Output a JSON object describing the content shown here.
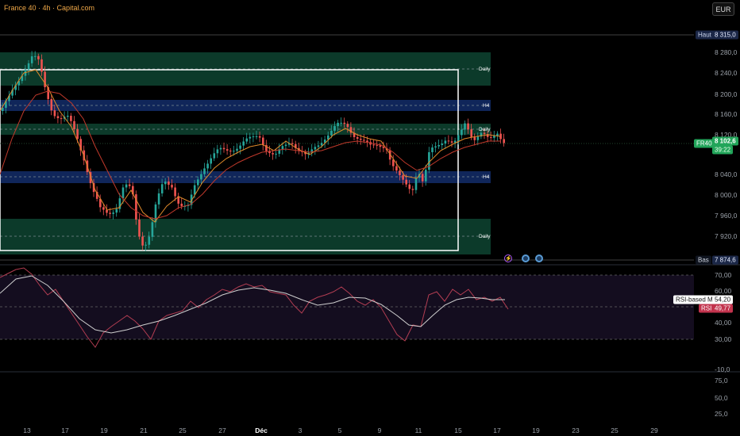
{
  "header": {
    "title": "France 40 · 4h · Capital.com"
  },
  "toolbar": {
    "currency": "EUR"
  },
  "price_axis": {
    "ticks": [
      "8 280,0",
      "8 240,0",
      "8 200,0",
      "8 160,0",
      "8 120,0",
      "8 040,0",
      "8 000,0",
      "7 960,0",
      "7 920,0"
    ],
    "high_label": "Haut",
    "high_value": "8 315,0",
    "low_label": "Bas",
    "low_value": "7 874,6",
    "symbol": "FR40",
    "last_price": "8 102,6",
    "countdown": "39:22"
  },
  "zones": {
    "daily_1": "Daily",
    "h4_1": "H4",
    "daily_2": "Daily",
    "h4_2": "H4",
    "daily_3": "Daily"
  },
  "rsi_pane": {
    "ticks": [
      "70,00",
      "60,00",
      "40,00",
      "30,00",
      "-10,0"
    ],
    "ma_label": "RSI-based MA",
    "ma_value": "54,20",
    "rsi_label": "RSI",
    "rsi_value": "49,77"
  },
  "lower_pane": {
    "ticks": [
      "75,0",
      "50,0",
      "25,0"
    ]
  },
  "time_axis": [
    "13",
    "17",
    "19",
    "21",
    "25",
    "27",
    "Déc",
    "3",
    "5",
    "9",
    "11",
    "15",
    "17",
    "19",
    "23",
    "25",
    "29"
  ],
  "event_icons": [
    "lightning-event",
    "dividend-event",
    "dividend-event"
  ],
  "colors": {
    "up": "#26a69a",
    "down": "#ef5350",
    "accent_green": "#22c55e",
    "daily_zone": "#0c3a2a",
    "h4_zone": "#10265a",
    "rsi_line": "#b23d52"
  }
}
